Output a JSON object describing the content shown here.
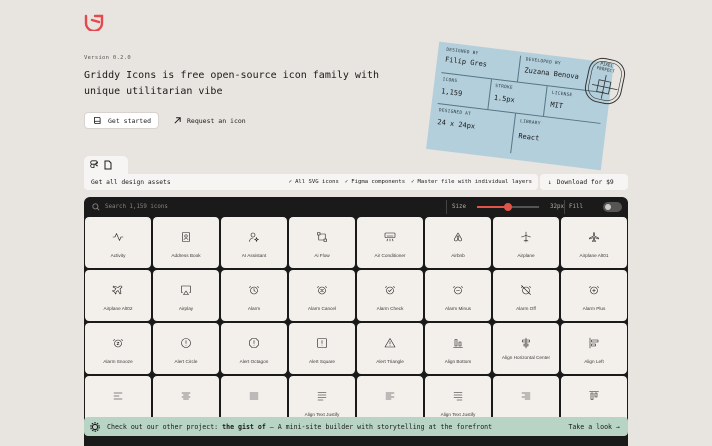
{
  "brand": {
    "accent": "#e5484d",
    "logo": "griddy-logo"
  },
  "hero": {
    "version": "Version 0.2.0",
    "headline": "Griddy Icons is free open-source icon family with unique utilitarian vibe",
    "get_started": "Get started",
    "request_icon": "Request an icon"
  },
  "ticket": {
    "designed_by_label": "DESIGNED BY",
    "designed_by": "Filip Gres",
    "developed_by_label": "DEVELOPED BY",
    "developed_by": "Zuzana Benova",
    "icons_label": "ICONS",
    "icons": "1,159",
    "stroke_label": "STROKE",
    "stroke": "1.5px",
    "license_label": "LICENSE",
    "license": "MIT",
    "designed_at_label": "DESIGNED AT",
    "designed_at": "24 x 24px",
    "library_label": "LIBRARY",
    "library": "React",
    "stamp": "PIXEL PERFECT"
  },
  "assets": {
    "title": "Get all design assets",
    "features": [
      "All SVG icons",
      "Figma components",
      "Master file with individual layers"
    ],
    "download": "Download for $9"
  },
  "toolbar": {
    "search_placeholder": "Search 1,159 icons",
    "size_label": "Size",
    "size_value": "32px",
    "size_fraction": 0.5,
    "fill_label": "Fill",
    "fill_on": false
  },
  "icons": [
    {
      "label": "Activity",
      "icon": "activity-icon"
    },
    {
      "label": "Address Book",
      "icon": "address-book-icon"
    },
    {
      "label": "AI Assistant",
      "icon": "ai-assistant-icon"
    },
    {
      "label": "Ai Flow",
      "icon": "ai-flow-icon"
    },
    {
      "label": "Air Conditioner",
      "icon": "air-conditioner-icon"
    },
    {
      "label": "Airbnb",
      "icon": "airbnb-icon"
    },
    {
      "label": "Airplane",
      "icon": "airplane-icon"
    },
    {
      "label": "Airplane Alt01",
      "icon": "airplane-alt01-icon"
    },
    {
      "label": "Airplane Alt02",
      "icon": "airplane-alt02-icon"
    },
    {
      "label": "Airplay",
      "icon": "airplay-icon"
    },
    {
      "label": "Alarm",
      "icon": "alarm-icon"
    },
    {
      "label": "Alarm Cancel",
      "icon": "alarm-cancel-icon"
    },
    {
      "label": "Alarm Check",
      "icon": "alarm-check-icon"
    },
    {
      "label": "Alarm Minus",
      "icon": "alarm-minus-icon"
    },
    {
      "label": "Alarm Off",
      "icon": "alarm-off-icon"
    },
    {
      "label": "Alarm Plus",
      "icon": "alarm-plus-icon"
    },
    {
      "label": "Alarm Snooze",
      "icon": "alarm-snooze-icon"
    },
    {
      "label": "Alert Circle",
      "icon": "alert-circle-icon"
    },
    {
      "label": "Alert Octagon",
      "icon": "alert-octagon-icon"
    },
    {
      "label": "Alert Square",
      "icon": "alert-square-icon"
    },
    {
      "label": "Alert Triangle",
      "icon": "alert-triangle-icon"
    },
    {
      "label": "Align Bottom",
      "icon": "align-bottom-icon"
    },
    {
      "label": "Align Horizontal Center",
      "icon": "align-horizontal-center-icon"
    },
    {
      "label": "Align Left",
      "icon": "align-left-icon"
    },
    {
      "label": "",
      "icon": "align-icon"
    },
    {
      "label": "",
      "icon": "align-text-center-icon"
    },
    {
      "label": "",
      "icon": "align-text-icon"
    },
    {
      "label": "Align Text Justify",
      "icon": "align-text-justify-icon"
    },
    {
      "label": "",
      "icon": "align-text-left-icon"
    },
    {
      "label": "Align Text Justify",
      "icon": "align-text-justify-alt-icon"
    },
    {
      "label": "",
      "icon": "align-text-right-icon"
    },
    {
      "label": "",
      "icon": "align-top-icon"
    }
  ],
  "promo": {
    "prefix": "Check out our other project:",
    "project": "the gist of",
    "suffix": "– A mini-site builder with storytelling at the forefront",
    "link": "Take a look"
  }
}
